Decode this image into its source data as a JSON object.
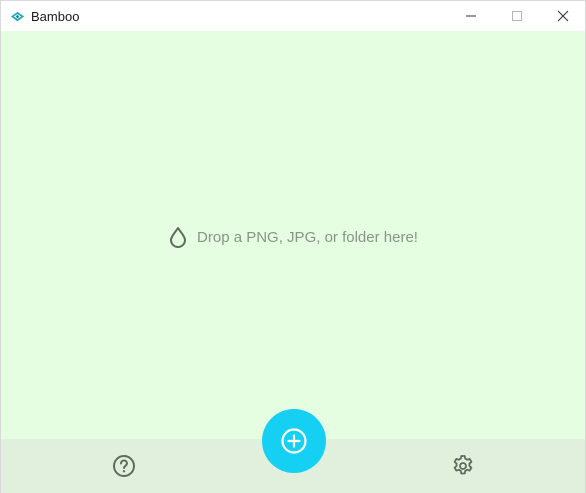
{
  "window": {
    "title": "Bamboo",
    "controls": {
      "minimize_icon": "minimize-icon",
      "maximize_icon": "maximize-icon",
      "close_icon": "close-icon"
    }
  },
  "drop_zone": {
    "icon": "droplet-icon",
    "text": "Drop a PNG, JPG, or folder here!"
  },
  "footer": {
    "help_icon": "help-circle-icon",
    "add_icon": "plus-circle-icon",
    "settings_icon": "gear-icon"
  },
  "colors": {
    "background": "#e5fde0",
    "footer": "#e1efdd",
    "accent": "#16d0f3",
    "icon": "#5f6b5f"
  }
}
